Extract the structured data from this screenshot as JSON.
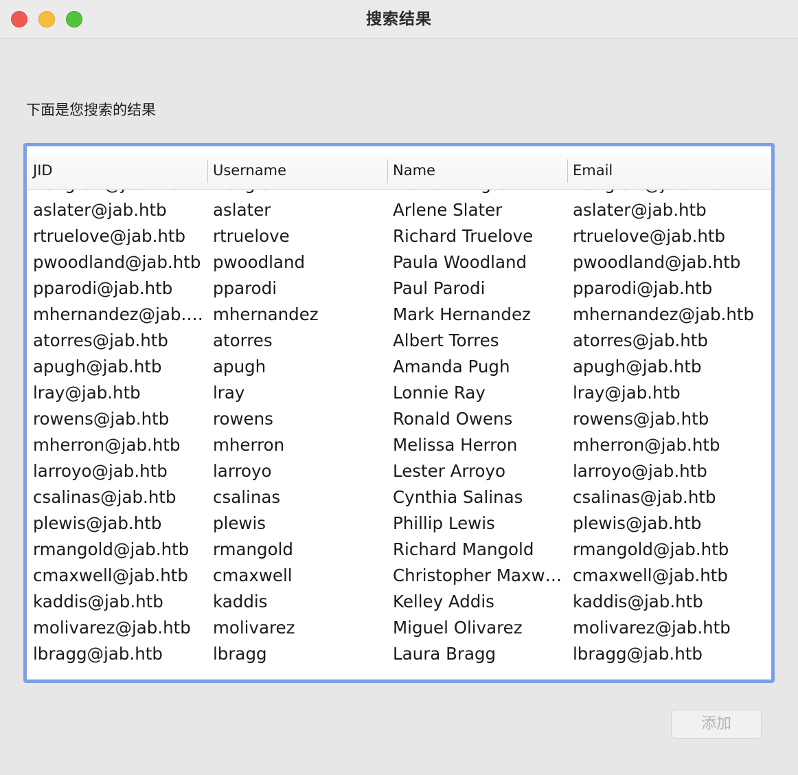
{
  "window": {
    "title": "搜索结果"
  },
  "subtitle": "下面是您搜索的结果",
  "table": {
    "columns": [
      "JID",
      "Username",
      "Name",
      "Email"
    ],
    "rows": [
      {
        "jid": "nenglert@jab.htb",
        "username": "nenglert",
        "name": "Nathan Englert",
        "email": "nenglert@jab.htb"
      },
      {
        "jid": "aslater@jab.htb",
        "username": "aslater",
        "name": "Arlene Slater",
        "email": "aslater@jab.htb"
      },
      {
        "jid": "rtruelove@jab.htb",
        "username": "rtruelove",
        "name": "Richard Truelove",
        "email": "rtruelove@jab.htb"
      },
      {
        "jid": "pwoodland@jab.htb",
        "username": "pwoodland",
        "name": "Paula Woodland",
        "email": "pwoodland@jab.htb"
      },
      {
        "jid": "pparodi@jab.htb",
        "username": "pparodi",
        "name": "Paul Parodi",
        "email": "pparodi@jab.htb"
      },
      {
        "jid": "mhernandez@jab.htb",
        "username": "mhernandez",
        "name": "Mark Hernandez",
        "email": "mhernandez@jab.htb"
      },
      {
        "jid": "atorres@jab.htb",
        "username": "atorres",
        "name": "Albert Torres",
        "email": "atorres@jab.htb"
      },
      {
        "jid": "apugh@jab.htb",
        "username": "apugh",
        "name": "Amanda Pugh",
        "email": "apugh@jab.htb"
      },
      {
        "jid": "lray@jab.htb",
        "username": "lray",
        "name": "Lonnie Ray",
        "email": "lray@jab.htb"
      },
      {
        "jid": "rowens@jab.htb",
        "username": "rowens",
        "name": "Ronald Owens",
        "email": "rowens@jab.htb"
      },
      {
        "jid": "mherron@jab.htb",
        "username": "mherron",
        "name": "Melissa Herron",
        "email": "mherron@jab.htb"
      },
      {
        "jid": "larroyo@jab.htb",
        "username": "larroyo",
        "name": "Lester Arroyo",
        "email": "larroyo@jab.htb"
      },
      {
        "jid": "csalinas@jab.htb",
        "username": "csalinas",
        "name": "Cynthia Salinas",
        "email": "csalinas@jab.htb"
      },
      {
        "jid": "plewis@jab.htb",
        "username": "plewis",
        "name": "Phillip Lewis",
        "email": "plewis@jab.htb"
      },
      {
        "jid": "rmangold@jab.htb",
        "username": "rmangold",
        "name": "Richard Mangold",
        "email": "rmangold@jab.htb"
      },
      {
        "jid": "cmaxwell@jab.htb",
        "username": "cmaxwell",
        "name": "Christopher Maxwell",
        "email": "cmaxwell@jab.htb"
      },
      {
        "jid": "kaddis@jab.htb",
        "username": "kaddis",
        "name": "Kelley Addis",
        "email": "kaddis@jab.htb"
      },
      {
        "jid": "molivarez@jab.htb",
        "username": "molivarez",
        "name": "Miguel Olivarez",
        "email": "molivarez@jab.htb"
      },
      {
        "jid": "lbragg@jab.htb",
        "username": "lbragg",
        "name": "Laura Bragg",
        "email": "lbragg@jab.htb"
      }
    ]
  },
  "buttons": {
    "add_label": "添加",
    "add_enabled": false
  },
  "colors": {
    "focus_ring": "#7c9fe7",
    "close": "#ee5a52",
    "minimize": "#f6bd3b",
    "zoom": "#55c23d"
  }
}
